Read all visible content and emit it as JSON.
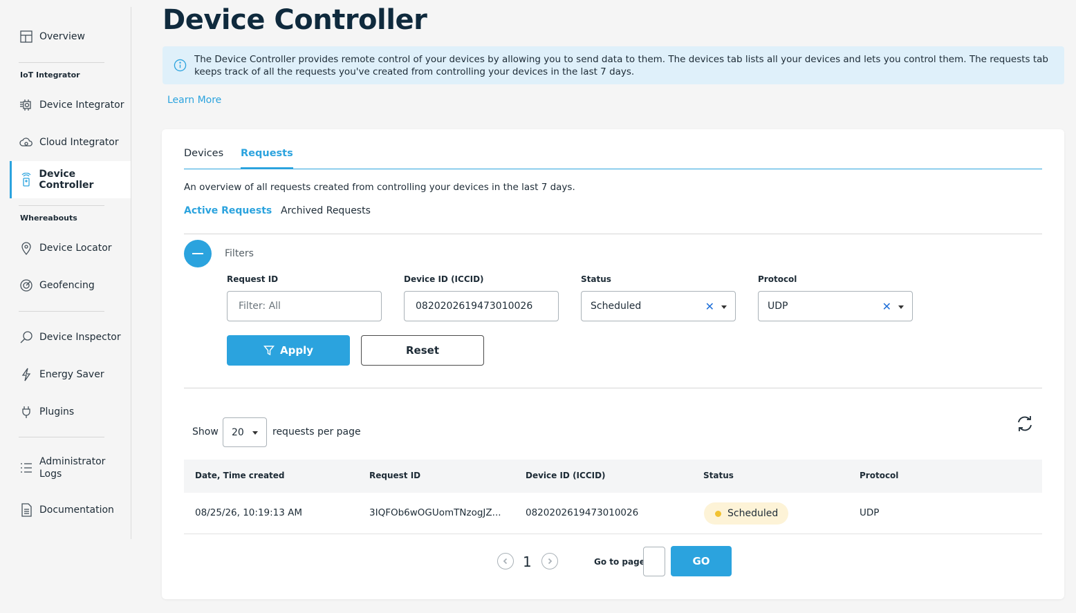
{
  "page": {
    "title": "Device Controller"
  },
  "info": {
    "text": "The Device Controller provides remote control of your devices by allowing you to send data to them. The devices tab lists all your devices and lets you control them. The requests tab keeps track of all the requests you've created from controlling your devices in the last 7 days.",
    "learn_more": "Learn More"
  },
  "sidebar": {
    "overview": "Overview",
    "section_iot": "IoT Integrator",
    "device_integrator": "Device Integrator",
    "cloud_integrator": "Cloud Integrator",
    "device_controller": "Device Controller",
    "section_whereabouts": "Whereabouts",
    "device_locator": "Device Locator",
    "geofencing": "Geofencing",
    "device_inspector": "Device Inspector",
    "energy_saver": "Energy Saver",
    "plugins": "Plugins",
    "admin_logs_1": "Administrator",
    "admin_logs_2": "Logs",
    "documentation": "Documentation",
    "accent": "#2ba3de"
  },
  "tabs": {
    "devices": "Devices",
    "requests": "Requests"
  },
  "requests": {
    "overview": "An overview of all requests created from controlling your devices in the last 7 days.",
    "active": "Active Requests",
    "archived": "Archived Requests"
  },
  "filters": {
    "label": "Filters",
    "request_id_label": "Request ID",
    "request_id_placeholder": "Filter: All",
    "device_id_label": "Device ID (ICCID)",
    "device_id_value": "0820202619473010026",
    "status_label": "Status",
    "status_value": "Scheduled",
    "protocol_label": "Protocol",
    "protocol_value": "UDP",
    "apply": "Apply",
    "reset": "Reset"
  },
  "pagination": {
    "show": "Show",
    "per_page": "20",
    "per_page_label": "requests per page",
    "page": "1",
    "goto_label": "Go to page",
    "go": "GO"
  },
  "table": {
    "headers": [
      "Date, Time created",
      "Request ID",
      "Device ID (ICCID)",
      "Status",
      "Protocol"
    ],
    "rows": [
      {
        "date": "08/25/26, 10:19:13 AM",
        "request_id": "3IQFOb6wOGUomTNzogJZ...",
        "device_id": "0820202619473010026",
        "status": "Scheduled",
        "protocol": "UDP"
      }
    ],
    "status_color": "#f1c232"
  }
}
